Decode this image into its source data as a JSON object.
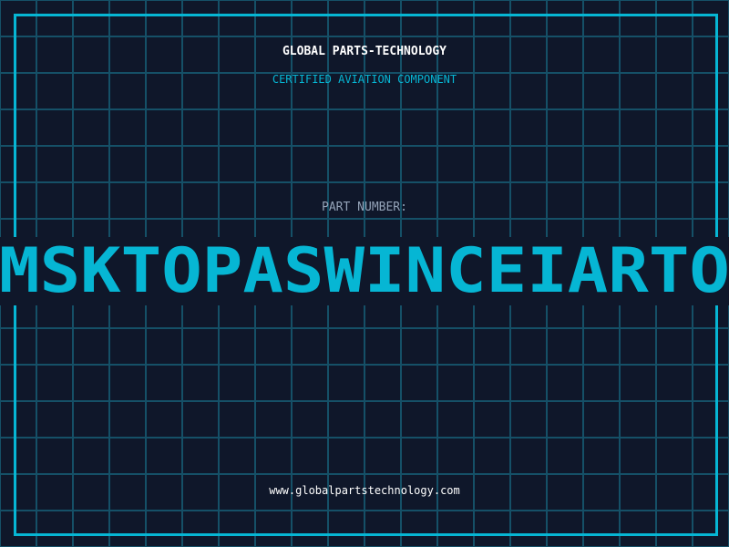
{
  "header": {
    "company": "GLOBAL PARTS-TECHNOLOGY",
    "subtitle": "CERTIFIED AVIATION COMPONENT"
  },
  "part": {
    "label": "PART NUMBER:",
    "number": "MSKTOPASWINCEIARTO"
  },
  "footer": {
    "url": "www.globalpartstechnology.com"
  },
  "colors": {
    "background": "#0f172a",
    "accent": "#06b6d4",
    "grid": "#155067",
    "label": "#94a3b8"
  }
}
